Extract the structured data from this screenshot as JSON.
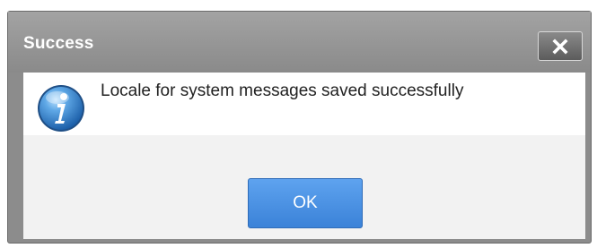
{
  "dialog": {
    "title": "Success",
    "close_icon": "close-icon",
    "info_icon": "info-icon",
    "message": "Locale for system messages saved successfully",
    "ok_label": "OK",
    "colors": {
      "titlebar": "#999999",
      "button_primary": "#4a90e2",
      "footer_bg": "#f2f2f2"
    }
  }
}
